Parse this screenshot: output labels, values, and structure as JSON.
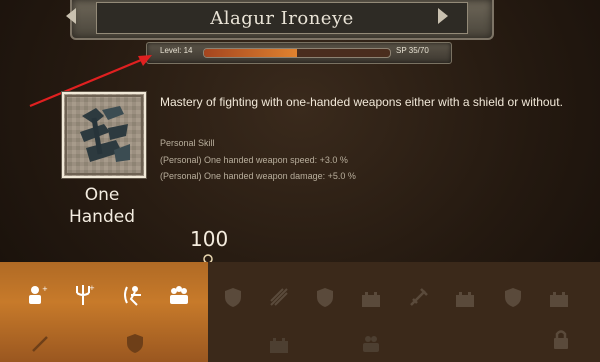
{
  "header": {
    "character_name": "Alagur Ironeye"
  },
  "progress": {
    "level_label": "Level: 14",
    "sp_label": "SP 35/70",
    "fill_fraction": 0.5
  },
  "skill": {
    "name": "One Handed",
    "description": "Mastery of fighting with one-handed weapons either with a shield or without.",
    "personal_label": "Personal Skill",
    "effects": [
      "(Personal) One handed weapon speed: +3.0 %",
      "(Personal) One handed weapon damage: +5.0 %"
    ]
  },
  "perk_threshold": "100",
  "colors": {
    "accent": "#c77a2a",
    "annotation": "#e02020",
    "bar_fill": "#e0822f"
  },
  "perks": {
    "lit_icons": [
      "trainer-icon",
      "trident-icon",
      "archer-icon",
      "group-icon"
    ],
    "dim_icons": [
      "shield-icon",
      "arrows-icon",
      "shield-icon",
      "castle-icon",
      "sword-icon",
      "castle-icon",
      "shield-icon",
      "castle-icon",
      "lock-icon"
    ]
  }
}
